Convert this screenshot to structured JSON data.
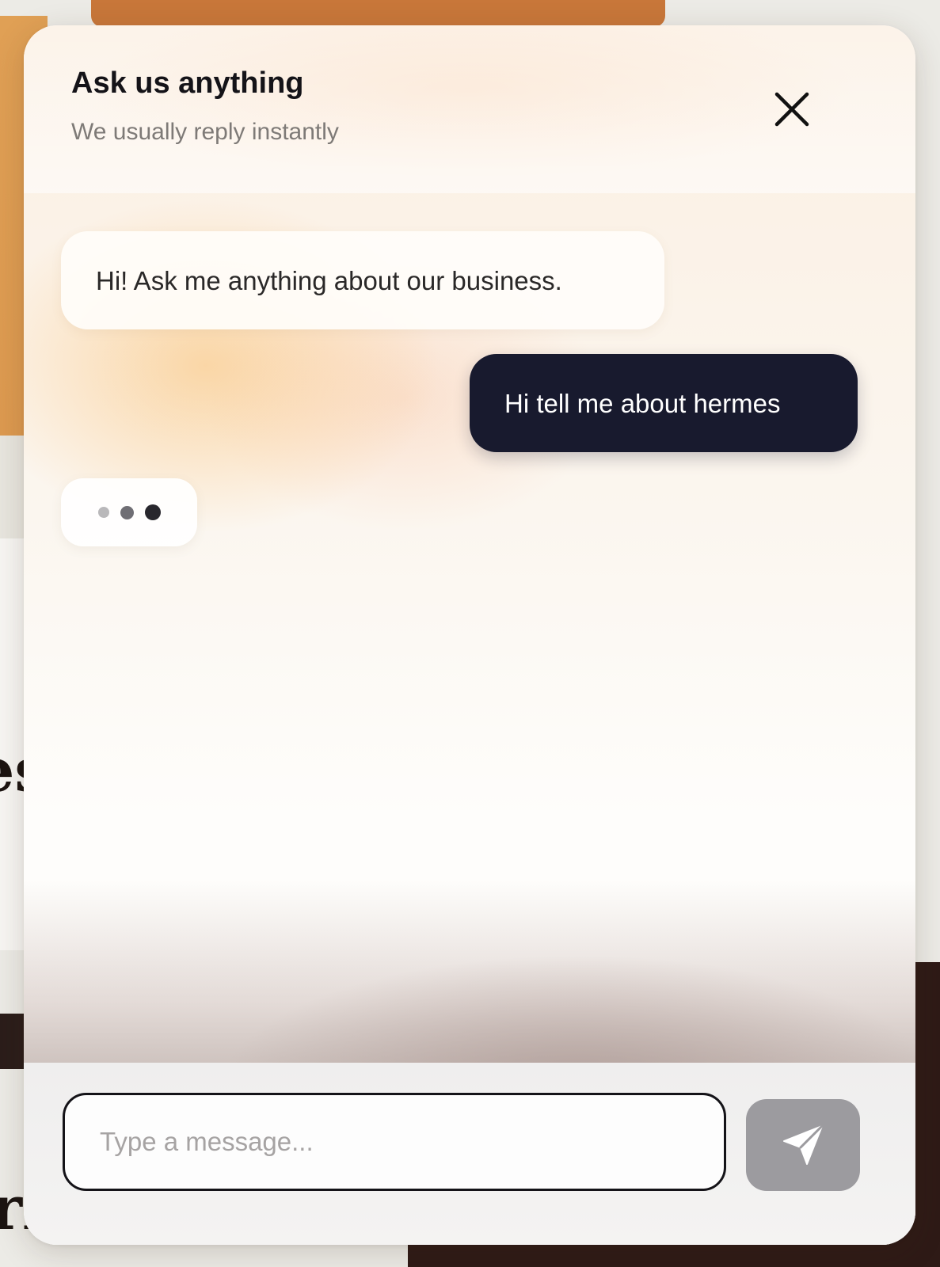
{
  "chat": {
    "title": "Ask us anything",
    "subtitle": "We usually reply instantly",
    "close_icon": "close-icon",
    "messages": [
      {
        "role": "bot",
        "text": "Hi! Ask me anything about our business."
      },
      {
        "role": "user",
        "text": "Hi tell me about hermes"
      }
    ],
    "typing_indicator": true,
    "input": {
      "value": "",
      "placeholder": "Type a message..."
    },
    "send_icon": "send-icon"
  },
  "background_page": {
    "heading_fragment_1": "es",
    "heading_fragment_2": "ri"
  },
  "colors": {
    "user_bubble": "#181a2e",
    "send_button": "#9c9b9f",
    "accent_orange": "#c8773a",
    "dark_band": "#2e1a16"
  }
}
